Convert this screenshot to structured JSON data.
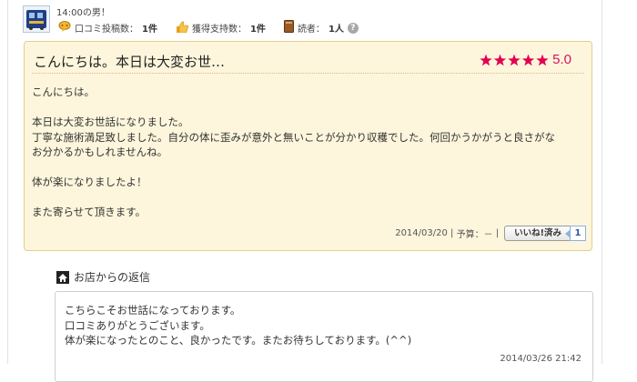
{
  "reviewer": {
    "name": "14:00の男！",
    "review_count_label": "口コミ投稿数：",
    "review_count": "1件",
    "support_count_label": "獲得支持数：",
    "support_count": "1件",
    "reader_count_label": "読者：",
    "reader_count": "1人",
    "help_icon": "?"
  },
  "review": {
    "title": "こんにちは。本日は大変お世…",
    "rating": {
      "stars": 5,
      "max": 5,
      "score": "5.0",
      "color": "#e3004f"
    },
    "body": [
      "こんにちは。",
      "",
      "本日は大変お世話になりました。",
      "丁寧な施術満足致しました。自分の体に歪みが意外と無いことが分かり収穫でした。何回かうかがうと良さがな",
      "お分かるかもしれませんね。",
      "",
      "体が楽になりましたよ！",
      "",
      "また寄らせて頂きます。"
    ],
    "date": "2014/03/20",
    "separator": "|",
    "budget_label": "予算：",
    "budget_value": "－",
    "like_button": "いいね!済み",
    "like_count": "1"
  },
  "reply": {
    "heading": "お店からの返信",
    "body": [
      "こちらこそお世話になっております。",
      "口コミありがとうございます。",
      "体が楽になったとのこと、良かったです。またお待ちしております。(^^)"
    ],
    "date": "2014/03/26 21:42"
  },
  "icons": {
    "avatar": "train-avatar-icon",
    "review_count": "speech-bubble-icon",
    "support_count": "thumbs-up-icon",
    "readers": "book-icon",
    "help": "question-icon",
    "reply": "home-icon"
  }
}
